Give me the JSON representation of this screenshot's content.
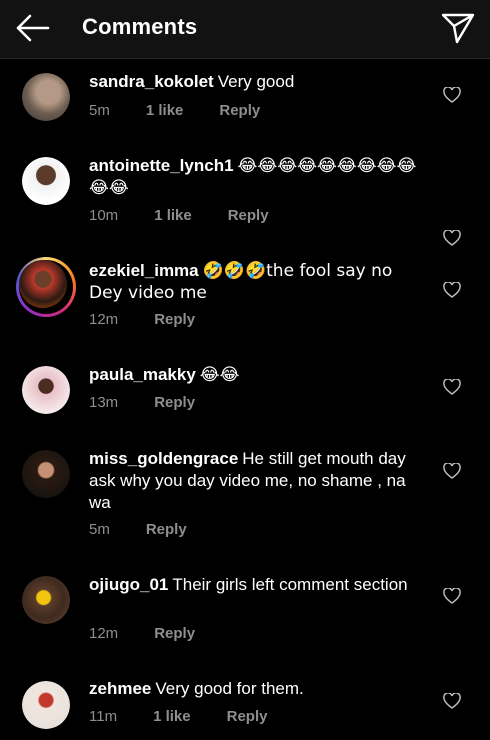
{
  "header": {
    "title": "Comments",
    "back_icon": "arrow-left-icon",
    "send_icon": "paper-plane-icon"
  },
  "comments": [
    {
      "username": "sandra_kokolet",
      "text": "Very good",
      "time": "5m",
      "likes": "1 like",
      "reply": "Reply"
    },
    {
      "username": "antoinette_lynch1",
      "text": "😂😂😂😂😂😂😂😂😂😂😂",
      "time": "10m",
      "likes": "1 like",
      "reply": "Reply"
    },
    {
      "username": "ezekiel_imma",
      "text": "🤣🤣🤣the fool say no Dey video me",
      "time": "12m",
      "reply": "Reply"
    },
    {
      "username": "paula_makky",
      "text": "😂😂",
      "time": "13m",
      "reply": "Reply"
    },
    {
      "username": "miss_goldengrace",
      "text": "He still get mouth day ask why you day video me, no shame , na wa",
      "time": "5m",
      "reply": "Reply"
    },
    {
      "username": "ojiugo_01",
      "text": "Their girls left comment section",
      "time": "12m",
      "reply": "Reply"
    },
    {
      "username": "zehmee",
      "text": "Very good for them.",
      "time": "11m",
      "likes": "1 like",
      "reply": "Reply"
    }
  ],
  "colors": {
    "background": "#000000",
    "header": "#121212",
    "meta": "#8e8e8e"
  }
}
